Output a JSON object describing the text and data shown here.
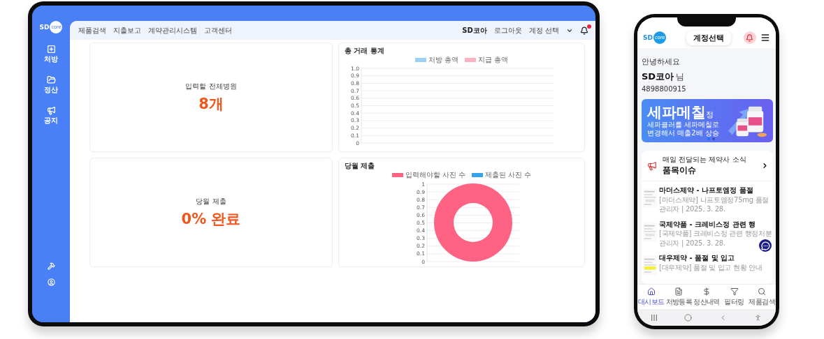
{
  "tablet": {
    "sidebar": {
      "logo": {
        "text": "SD",
        "badge": "core"
      },
      "items": [
        {
          "label": "처방"
        },
        {
          "label": "정산"
        },
        {
          "label": "공지"
        }
      ]
    },
    "header": {
      "menu": [
        "제품검색",
        "지출보고",
        "계약관리시스템",
        "고객센터"
      ],
      "user": "SD코아",
      "logout": "로그아웃",
      "account": "계정 선택"
    },
    "cards": [
      {
        "kind": "stat",
        "label": "입력할 전체병원",
        "value": "8개"
      },
      {
        "kind": "chart",
        "title": "총 거래 통계",
        "chart_data": {
          "type": "line",
          "series": [
            {
              "name": "처방 총액",
              "color": "#9ad0f5"
            },
            {
              "name": "지급 총액",
              "color": "#ffb1c1"
            }
          ],
          "ylim": [
            0,
            1
          ],
          "yticks": [
            0,
            0.1,
            0.2,
            0.3,
            0.4,
            0.5,
            0.6,
            0.7,
            0.8,
            0.9,
            {
              "value": 1,
              "label": "1.0"
            }
          ],
          "grid": true
        }
      },
      {
        "kind": "stat",
        "label": "당월 제출",
        "value": "0% 완료"
      },
      {
        "kind": "donut",
        "title": "당월 제출",
        "legend": [
          {
            "name": "입력해야할 사진 수",
            "color": "#ff6384"
          },
          {
            "name": "제출된 사진 수",
            "color": "#36a2eb"
          }
        ],
        "axis_labels": [
          "1",
          "0.9",
          "0.8",
          "0.7",
          "0.6",
          "0.5",
          "0.4",
          "0.3",
          "0.2",
          "0.1",
          "0"
        ]
      }
    ]
  },
  "phone": {
    "logo": {
      "text": "SD",
      "badge": "core"
    },
    "account_button": "계정선택",
    "greeting": "안녕하세요",
    "user_name": "SD코아",
    "honorific": "님",
    "user_id": "4898800915",
    "banner": {
      "title": "세파메칠",
      "title_suffix": "정",
      "subtitle": "세파클러를 세파메칠로 변경해서 매출2배 상승",
      "dots": [
        {
          "selected": true
        },
        {
          "selected": false
        }
      ]
    },
    "news": {
      "caption": "매일 전달되는 제약사 소식",
      "title": "품목이슈",
      "items": [
        {
          "title": "마더스제약 - 나프토엠정 품절",
          "summary": "[마더스제약] 나프토엠정75mg 품절",
          "meta": "관리자 | 2025. 3. 28."
        },
        {
          "title": "국제약품 - 크레비스정 관련 행",
          "summary": "[국제약품] 크레비스정 관련 행정처분",
          "meta": "관리자 | 2025. 3. 28."
        },
        {
          "title": "대우제약 - 품절 및 입고",
          "summary": "[대우제약] 품절 및 입고 현황 안내"
        }
      ]
    },
    "bottom_nav": [
      {
        "label": "대시보드",
        "selected": true
      },
      {
        "label": "처방등록",
        "selected": false
      },
      {
        "label": "정산내역",
        "selected": false
      },
      {
        "label": "필터링",
        "selected": false
      },
      {
        "label": "제품검색",
        "selected": false
      }
    ]
  }
}
